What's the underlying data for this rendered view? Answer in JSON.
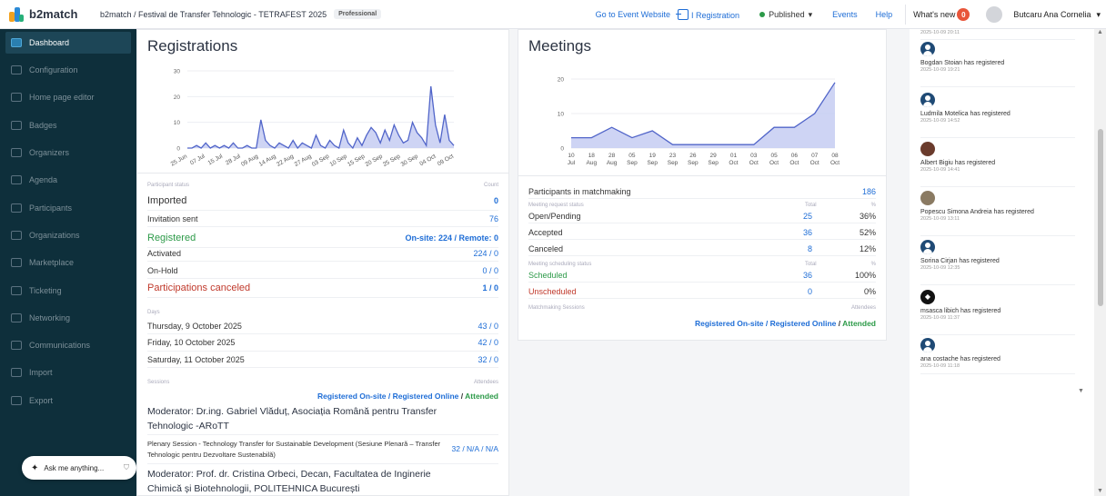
{
  "app": {
    "logo_text": "b2match",
    "breadcrumb": "b2match / Festival de Transfer Tehnologic - TETRAFEST 2025",
    "plan": "Professional"
  },
  "topnav": {
    "event_website": "Go to Event Website",
    "registration": "I Registration",
    "status": "Published",
    "events": "Events",
    "help": "Help",
    "whats_new": "What's new",
    "whats_new_count": "0",
    "user_name": "Butcaru Ana Cornelia"
  },
  "sidebar": {
    "items": [
      {
        "label": "Dashboard",
        "icon": "dashboard-icon"
      },
      {
        "label": "Configuration",
        "icon": "gear-icon"
      },
      {
        "label": "Home page editor",
        "icon": "page-icon"
      },
      {
        "label": "Badges",
        "icon": "badge-icon"
      },
      {
        "label": "Organizers",
        "icon": "users-icon"
      },
      {
        "label": "Agenda",
        "icon": "calendar-icon"
      },
      {
        "label": "Participants",
        "icon": "users-icon"
      },
      {
        "label": "Organizations",
        "icon": "building-icon"
      },
      {
        "label": "Marketplace",
        "icon": "list-icon"
      },
      {
        "label": "Ticketing",
        "icon": "ticket-icon"
      },
      {
        "label": "Networking",
        "icon": "network-icon"
      },
      {
        "label": "Communications",
        "icon": "chat-icon"
      },
      {
        "label": "Import",
        "icon": "import-icon"
      },
      {
        "label": "Export",
        "icon": "export-icon"
      }
    ],
    "ask_placeholder": "Ask me anything..."
  },
  "registrations": {
    "title": "Registrations",
    "participant_status_label": "Participant status",
    "count_label": "Count",
    "rows": [
      {
        "label": "Imported",
        "value": "0"
      },
      {
        "label": "Invitation sent",
        "value": "76"
      },
      {
        "label": "Registered",
        "value": "On-site: 224 / Remote: 0"
      },
      {
        "label": "Activated",
        "value": "224 / 0"
      },
      {
        "label": "On-Hold",
        "value": "0 / 0"
      },
      {
        "label": "Participations canceled",
        "value": "1 / 0"
      }
    ],
    "days_label": "Days",
    "days": [
      {
        "label": "Thursday, 9 October 2025",
        "value": "43 / 0"
      },
      {
        "label": "Friday, 10 October 2025",
        "value": "42 / 0"
      },
      {
        "label": "Saturday, 11 October 2025",
        "value": "32 / 0"
      }
    ],
    "sessions_label": "Sessions",
    "attendees_label": "Attendees",
    "legend_onsite": "Registered On-site",
    "legend_online": "Registered Online",
    "legend_attended": "Attended",
    "moderator1": "Moderator: Dr.ing. Gabriel Vlăduț, Asociația Română pentru Transfer Tehnologic -ARoTT",
    "session1": "Plenary Session - Technology Transfer for Sustainable Development (Sesiune Plenară – Transfer Tehnologic pentru Dezvoltare Sustenabilă)",
    "session1_value": "32 / N/A / N/A",
    "moderator2": "Moderator: Prof. dr. Cristina Orbeci, Decan, Facultatea de Inginerie Chimică și Biotehnologii, POLITEHNICA București"
  },
  "meetings": {
    "title": "Meetings",
    "participants_label": "Participants in matchmaking",
    "participants_value": "186",
    "request_status_label": "Meeting request status",
    "total_label": "Total",
    "pct_label": "%",
    "requests": [
      {
        "label": "Open/Pending",
        "total": "25",
        "pct": "36%"
      },
      {
        "label": "Accepted",
        "total": "36",
        "pct": "52%"
      },
      {
        "label": "Canceled",
        "total": "8",
        "pct": "12%"
      }
    ],
    "scheduling_label": "Meeting scheduling status",
    "scheduling": [
      {
        "label": "Scheduled",
        "total": "36",
        "pct": "100%"
      },
      {
        "label": "Unscheduled",
        "total": "0",
        "pct": "0%"
      }
    ],
    "sessions_label": "Matchmaking Sessions",
    "attendees_label": "Attendees"
  },
  "activity": {
    "top_time": "2025-10-09 20:11",
    "items": [
      {
        "text": "Bogdan Stoian has registered",
        "time": "2025-10-09 19:21",
        "avatar": "person-icon"
      },
      {
        "text": "Ludmila Motelica has registered",
        "time": "2025-10-09 14:52",
        "avatar": "person-icon"
      },
      {
        "text": "Albert Bigiu has registered",
        "time": "2025-10-09 14:41",
        "avatar": "photo"
      },
      {
        "text": "Popescu Simona Andreia has registered",
        "time": "2025-10-09 13:11",
        "avatar": "photo"
      },
      {
        "text": "Sorina Cirjan has registered",
        "time": "2025-10-09 12:35",
        "avatar": "person-icon"
      },
      {
        "text": "msasca libich has registered",
        "time": "2025-10-09 11:37",
        "avatar": "logo"
      },
      {
        "text": "ana costache has registered",
        "time": "2025-10-09 11:18",
        "avatar": "person-icon"
      }
    ]
  },
  "colors": {
    "accent": "#1e6dd6",
    "sidebar": "#0e2f3b",
    "green": "#2c9a48",
    "red": "#c0392b",
    "chart_fill": "#c5cdf2",
    "chart_line": "#5165c9"
  },
  "chart_data": [
    {
      "type": "area",
      "title": "",
      "x": [
        "25 Jun",
        "07 Jul",
        "15 Jul",
        "28 Jul",
        "09 Aug",
        "14 Aug",
        "22 Aug",
        "27 Aug",
        "03 Sep",
        "10 Sep",
        "15 Sep",
        "20 Sep",
        "25 Sep",
        "30 Sep",
        "04 Oct",
        "09 Oct"
      ],
      "ylim": [
        0,
        30
      ],
      "yticks": [
        0,
        10,
        20,
        30
      ],
      "values": [
        0,
        0,
        1,
        0,
        2,
        0,
        1,
        0,
        1,
        0,
        2,
        0,
        0,
        1,
        0,
        0,
        11,
        3,
        1,
        0,
        2,
        1,
        0,
        3,
        0,
        2,
        1,
        0,
        5,
        1,
        0,
        3,
        1,
        0,
        7,
        2,
        0,
        4,
        1,
        5,
        8,
        6,
        2,
        7,
        3,
        9,
        5,
        2,
        3,
        10,
        6,
        4,
        1,
        24,
        9,
        2,
        13,
        3,
        1
      ],
      "grid": true,
      "legend": "none"
    },
    {
      "type": "area",
      "title": "",
      "x": [
        "10 Jul",
        "18 Aug",
        "28 Aug",
        "05 Sep",
        "19 Sep",
        "23 Sep",
        "26 Sep",
        "29 Sep",
        "01 Oct",
        "03 Oct",
        "05 Oct",
        "06 Oct",
        "07 Oct",
        "08 Oct"
      ],
      "ylim": [
        0,
        20
      ],
      "yticks": [
        0,
        10,
        20
      ],
      "values": [
        3,
        3,
        6,
        3,
        5,
        1,
        1,
        1,
        1,
        1,
        6,
        6,
        10,
        19
      ],
      "grid": true,
      "legend": "none"
    }
  ]
}
